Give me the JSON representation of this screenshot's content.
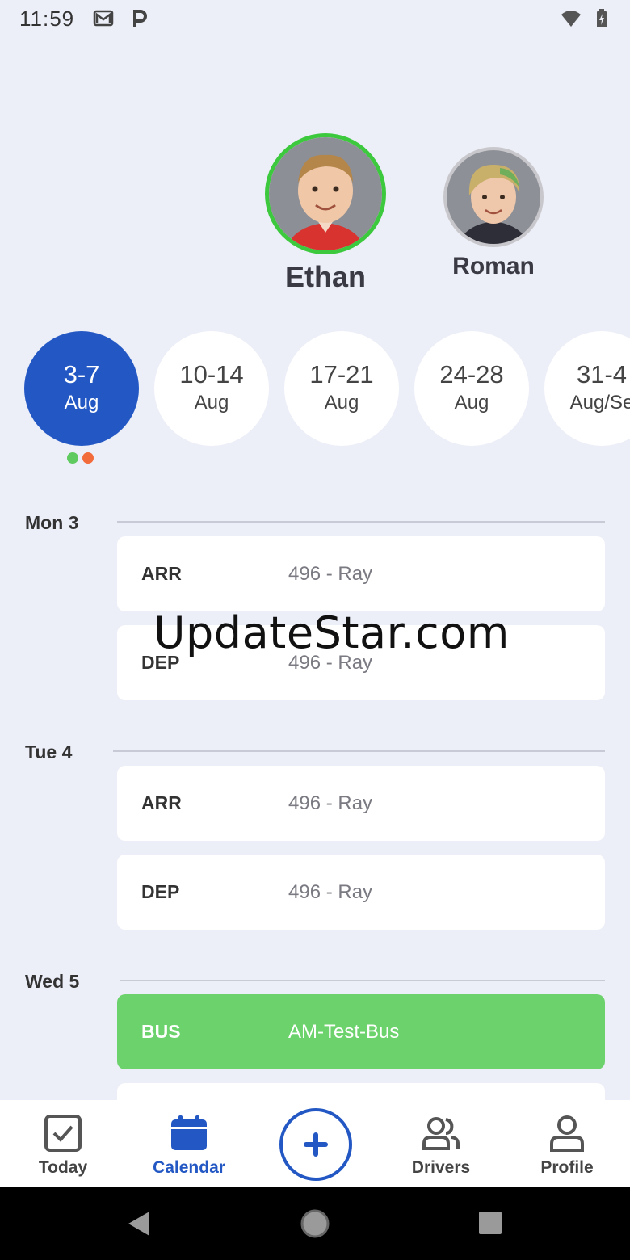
{
  "status_bar": {
    "time": "11:59",
    "icons": [
      "gmail-icon",
      "parking-icon",
      "wifi-icon",
      "battery-icon"
    ]
  },
  "students": [
    {
      "name": "Ethan",
      "selected": true
    },
    {
      "name": "Roman",
      "selected": false
    }
  ],
  "weeks": [
    {
      "range": "3-7",
      "month": "Aug",
      "active": true
    },
    {
      "range": "10-14",
      "month": "Aug",
      "active": false
    },
    {
      "range": "17-21",
      "month": "Aug",
      "active": false
    },
    {
      "range": "24-28",
      "month": "Aug",
      "active": false
    },
    {
      "range": "31-4",
      "month": "Aug/Se",
      "active": false
    }
  ],
  "week_dots": [
    "#5fca5f",
    "#f26b3a"
  ],
  "days": [
    {
      "label": "Mon 3",
      "entries": [
        {
          "type": "ARR",
          "route": "496 - Ray"
        },
        {
          "type": "DEP",
          "route": "496 - Ray"
        }
      ]
    },
    {
      "label": "Tue 4",
      "entries": [
        {
          "type": "ARR",
          "route": "496 - Ray"
        },
        {
          "type": "DEP",
          "route": "496 - Ray"
        }
      ]
    },
    {
      "label": "Wed 5",
      "entries": [
        {
          "type": "BUS",
          "route": "AM-Test-Bus"
        }
      ]
    }
  ],
  "watermark": "UpdateStar.com",
  "nav": {
    "today": "Today",
    "calendar": "Calendar",
    "drivers": "Drivers",
    "profile": "Profile",
    "active": "Calendar"
  },
  "colors": {
    "accent": "#2358c4",
    "bus": "#6cd26c",
    "selected_ring": "#3dc93d",
    "background": "#eceef8"
  }
}
